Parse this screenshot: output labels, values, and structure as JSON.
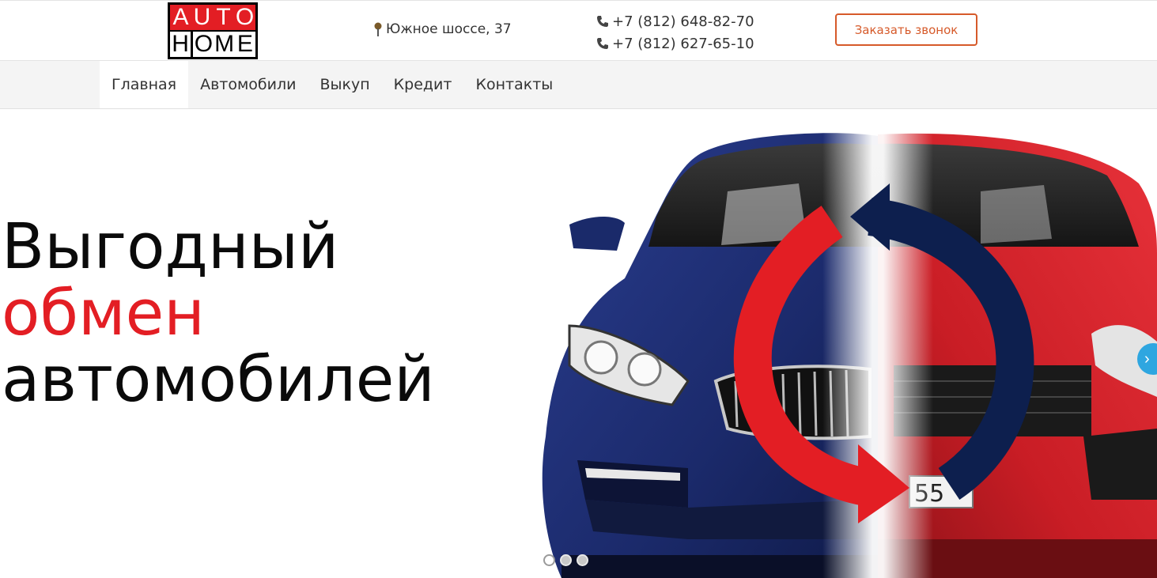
{
  "header": {
    "logo": {
      "top_letters": [
        "A",
        "U",
        "T",
        "O"
      ],
      "bottom_letters": [
        "H",
        "O",
        "M",
        "E"
      ],
      "top_text": "AUTO",
      "bottom_text": "HOME"
    },
    "address": {
      "icon": "map-pin-icon",
      "text": "Южное шоссе, 37"
    },
    "phones": [
      {
        "icon": "phone-icon",
        "number": "+7 (812) 648-82-70"
      },
      {
        "icon": "phone-icon",
        "number": "+7 (812) 627-65-10"
      }
    ],
    "callback_button": "Заказать звонок"
  },
  "nav": {
    "items": [
      {
        "label": "Главная",
        "active": true
      },
      {
        "label": "Автомобили",
        "active": false
      },
      {
        "label": "Выкуп",
        "active": false
      },
      {
        "label": "Кредит",
        "active": false
      },
      {
        "label": "Контакты",
        "active": false
      }
    ]
  },
  "hero": {
    "headline": {
      "line1": "Выгодный",
      "line2": "обмен",
      "line3": "автомобилей"
    },
    "next_arrow_icon": "chevron-right-icon",
    "slider": {
      "total_slides": 3,
      "active_slide": 1
    }
  },
  "colors": {
    "brand_red": "#e31e24",
    "button_orange": "#d65a2a",
    "navy": "#0d1f4e",
    "car_blue": "#1c2f7a",
    "car_red": "#d8222a",
    "accent_blue": "#2ea6e0"
  }
}
